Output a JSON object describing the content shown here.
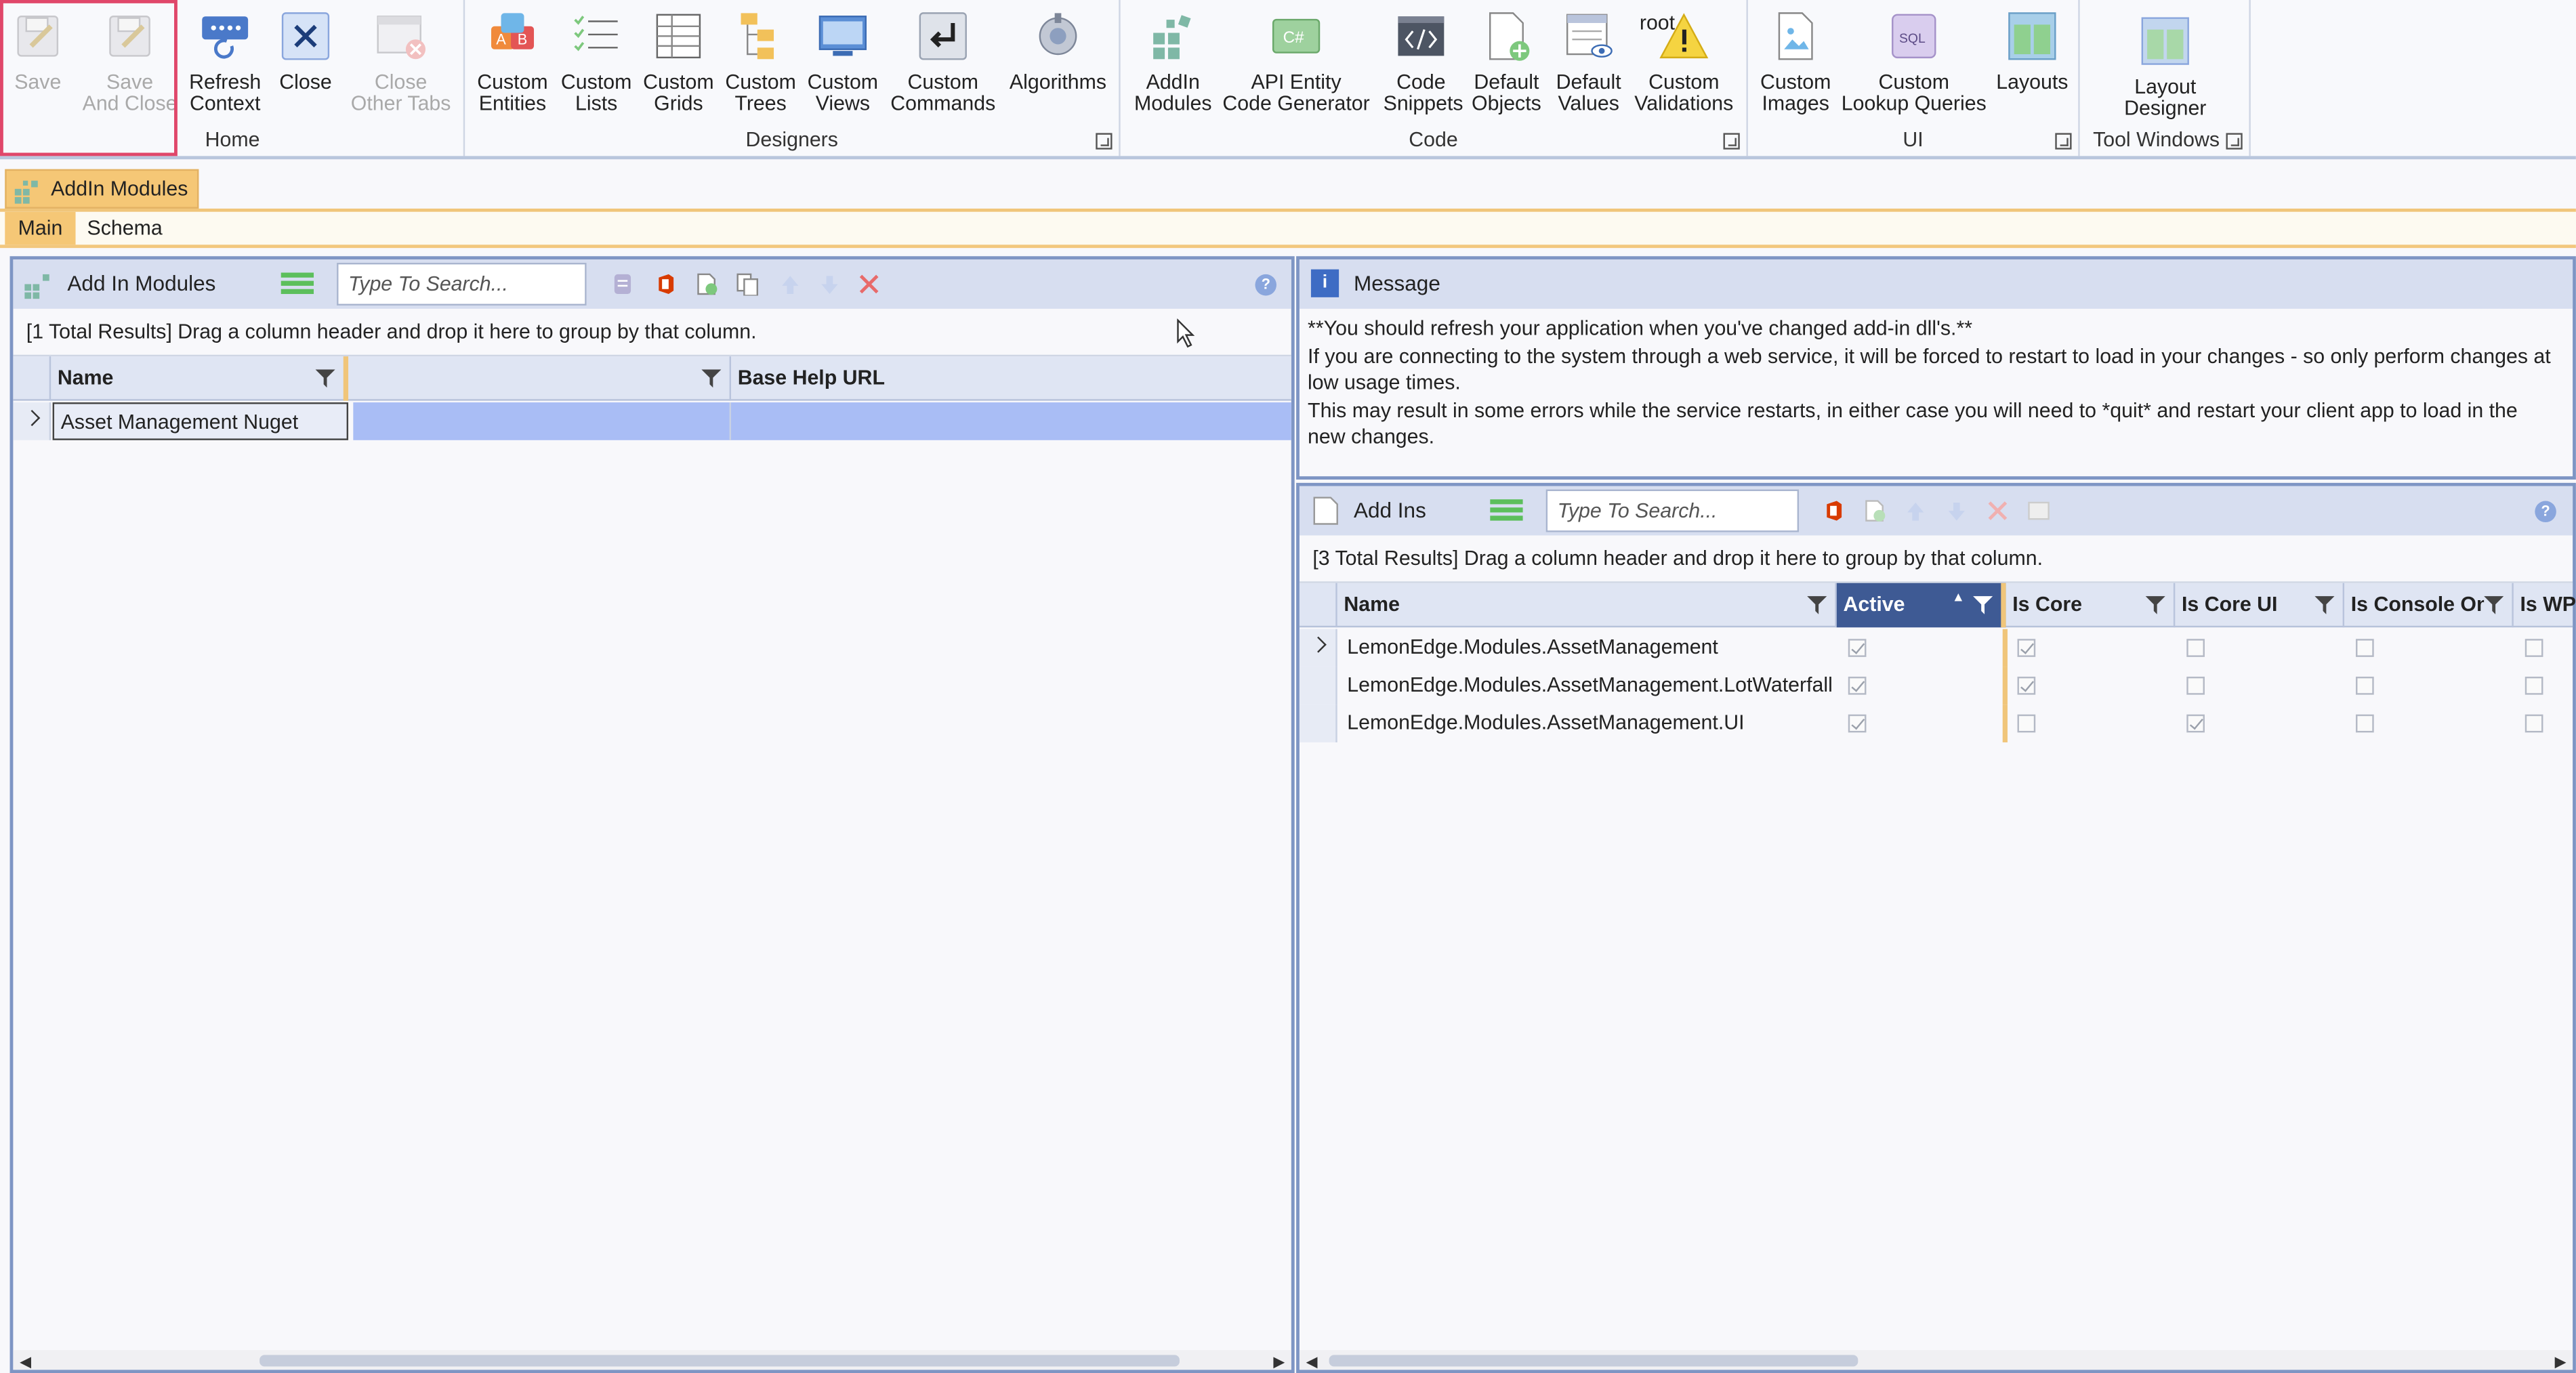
{
  "ribbon": {
    "home": {
      "label": "Home",
      "buttons": [
        {
          "label": "Save",
          "state": "disabled",
          "icon": "save-icon"
        },
        {
          "label": "Save And Close",
          "line1": "Save",
          "line2": "And Close",
          "state": "disabled",
          "icon": "save-close-icon"
        },
        {
          "label": "Refresh Context",
          "line1": "Refresh",
          "line2": "Context",
          "icon": "refresh-icon"
        },
        {
          "label": "Close",
          "icon": "close-icon"
        },
        {
          "label": "Close Other Tabs",
          "line1": "Close",
          "line2": "Other Tabs",
          "state": "disabled",
          "icon": "close-tabs-icon"
        }
      ]
    },
    "designers": {
      "label": "Designers",
      "buttons": [
        {
          "line1": "Custom",
          "line2": "Entities",
          "icon": "entities-icon"
        },
        {
          "line1": "Custom",
          "line2": "Lists",
          "icon": "lists-icon"
        },
        {
          "line1": "Custom",
          "line2": "Grids",
          "icon": "grids-icon"
        },
        {
          "line1": "Custom",
          "line2": "Trees",
          "icon": "trees-icon"
        },
        {
          "line1": "Custom",
          "line2": "Views",
          "icon": "views-icon"
        },
        {
          "line1": "Custom",
          "line2": "Commands",
          "icon": "commands-icon"
        },
        {
          "line1": "Algorithms",
          "line2": "",
          "icon": "algorithms-icon"
        }
      ]
    },
    "code": {
      "label": "Code",
      "buttons": [
        {
          "line1": "AddIn",
          "line2": "Modules",
          "icon": "addin-modules-icon"
        },
        {
          "line1": "API Entity",
          "line2": "Code Generator",
          "icon": "csharp-icon",
          "icon_text": "C#"
        },
        {
          "line1": "Code",
          "line2": "Snippets",
          "icon": "code-snippets-icon"
        },
        {
          "line1": "Default",
          "line2": "Objects",
          "icon": "default-objects-icon"
        },
        {
          "line1": "Default",
          "line2": "Values",
          "icon": "default-values-icon"
        },
        {
          "line1": "Custom",
          "line2": "Validations",
          "icon": "validations-icon",
          "overlay": "root"
        }
      ]
    },
    "ui": {
      "label": "UI",
      "buttons": [
        {
          "line1": "Custom",
          "line2": "Images",
          "icon": "images-icon"
        },
        {
          "line1": "Custom",
          "line2": "Lookup Queries",
          "icon": "sql-icon",
          "icon_text": "SQL"
        },
        {
          "line1": "Layouts",
          "line2": "",
          "icon": "layouts-icon"
        }
      ]
    },
    "tool_windows": {
      "label": "Tool Windows",
      "buttons": [
        {
          "line1": "Layout",
          "line2": "Designer",
          "icon": "layout-designer-icon"
        }
      ]
    }
  },
  "document_tab": {
    "label": "AddIn Modules"
  },
  "subtabs": [
    {
      "label": "Main",
      "active": true
    },
    {
      "label": "Schema",
      "active": false
    }
  ],
  "left_panel": {
    "title": "Add In Modules",
    "search_placeholder": "Type To Search...",
    "group_hint": "[1 Total Results] Drag a column header and drop it here to group by that column.",
    "columns": [
      "Name",
      "",
      "Base Help URL"
    ],
    "rows": [
      {
        "name": "Asset Management Nuget",
        "col2": "",
        "base_help_url": ""
      }
    ]
  },
  "message_panel": {
    "title": "Message",
    "lines": [
      "**You should refresh your application when you've changed add-in dll's.**",
      "If you are connecting to the system through a web service, it will be forced to restart to load in your changes - so only perform changes at low usage times.",
      "This may result in some errors while the service restarts, in either case you will need to *quit* and restart your client app to load in the new changes."
    ]
  },
  "addins_panel": {
    "title": "Add Ins",
    "search_placeholder": "Type To Search...",
    "group_hint": "[3 Total Results] Drag a column header and drop it here to group by that column.",
    "columns": [
      "Name",
      "Active",
      "Is Core",
      "Is Core UI",
      "Is Console Onl",
      "Is WP"
    ],
    "rows": [
      {
        "name": "LemonEdge.Modules.AssetManagement",
        "active": true,
        "is_core": true,
        "is_core_ui": false,
        "is_console_only": false,
        "is_wp": false
      },
      {
        "name": "LemonEdge.Modules.AssetManagement.LotWaterfall",
        "active": true,
        "is_core": true,
        "is_core_ui": false,
        "is_console_only": false,
        "is_wp": false
      },
      {
        "name": "LemonEdge.Modules.AssetManagement.UI",
        "active": true,
        "is_core": false,
        "is_core_ui": true,
        "is_console_only": false,
        "is_wp": false
      }
    ]
  },
  "colors": {
    "accent": "#f5c776",
    "panel_border": "#7e95c4",
    "sorted_header": "#3e5a94",
    "selected_row": "#a9bdf5"
  }
}
